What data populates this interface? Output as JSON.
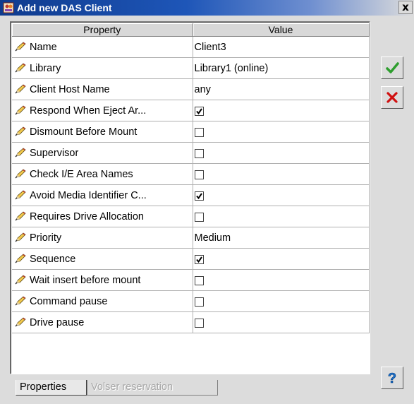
{
  "window": {
    "title": "Add new DAS Client",
    "close_label": "x"
  },
  "table": {
    "headers": [
      "Property",
      "Value"
    ],
    "rows": [
      {
        "property": "Name",
        "type": "text",
        "value": "Client3"
      },
      {
        "property": "Library",
        "type": "text",
        "value": "Library1 (online)"
      },
      {
        "property": "Client Host Name",
        "type": "text",
        "value": "any"
      },
      {
        "property": "Respond When Eject Ar...",
        "type": "checkbox",
        "checked": true
      },
      {
        "property": "Dismount Before Mount",
        "type": "checkbox",
        "checked": false
      },
      {
        "property": "Supervisor",
        "type": "checkbox",
        "checked": false
      },
      {
        "property": "Check I/E Area Names",
        "type": "checkbox",
        "checked": false
      },
      {
        "property": "Avoid Media Identifier C...",
        "type": "checkbox",
        "checked": true
      },
      {
        "property": "Requires Drive Allocation",
        "type": "checkbox",
        "checked": false
      },
      {
        "property": "Priority",
        "type": "text",
        "value": "Medium"
      },
      {
        "property": "Sequence",
        "type": "checkbox",
        "checked": true
      },
      {
        "property": "Wait insert before mount",
        "type": "checkbox",
        "checked": false
      },
      {
        "property": "Command pause",
        "type": "checkbox",
        "checked": false
      },
      {
        "property": "Drive pause",
        "type": "checkbox",
        "checked": false
      }
    ]
  },
  "side_buttons": {
    "ok_icon": "checkmark-icon",
    "cancel_icon": "red-x-icon",
    "help_icon": "question-mark-icon",
    "ok_color": "#2e9e2e",
    "cancel_color": "#d01010",
    "help_color": "#1a6fc8"
  },
  "tabs": [
    {
      "label": "Properties",
      "active": true
    },
    {
      "label": "Volser reservation",
      "active": false
    }
  ]
}
